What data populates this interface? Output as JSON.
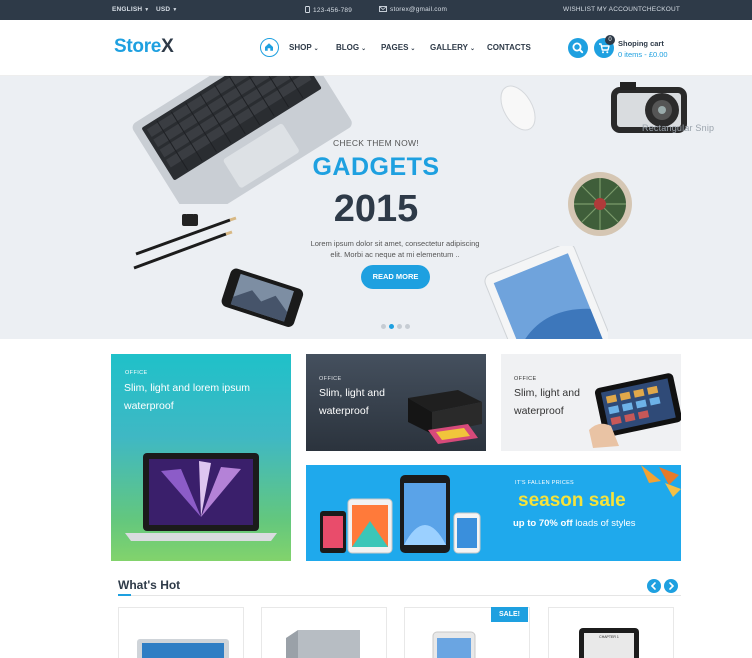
{
  "topbar": {
    "language": "ENGLISH",
    "currency": "USD",
    "phone": "123-456-789",
    "email": "storex@gmail.com",
    "wishlist": "WISHLIST",
    "my_account": "MY ACCOUNT",
    "checkout": "CHECKOUT"
  },
  "header": {
    "logo_main": "Store",
    "logo_accent": "X",
    "nav": [
      "SHOP",
      "BLOG",
      "PAGES",
      "GALLERY",
      "CONTACTS"
    ],
    "cart_title": "Shoping cart",
    "cart_summary": "0 items - £0.00",
    "cart_count": "0"
  },
  "hero": {
    "kicker": "CHECK THEM NOW!",
    "title": "GADGETS",
    "year": "2015",
    "text_line1": "Lorem ipsum dolor sit amet, consectetur adipiscing",
    "text_line2": "elit. Morbi ac neque at mi elementum ..",
    "button": "READ MORE",
    "slides": 4,
    "active_slide": 2,
    "overlay_label": "Rectangular Snip"
  },
  "banners": [
    {
      "tag": "OFFICE",
      "line1": "Slim, light and lorem ipsum",
      "line2": "waterproof"
    },
    {
      "tag": "OFFICE",
      "line1": "Slim, light and",
      "line2": "waterproof"
    },
    {
      "tag": "OFFICE",
      "line1": "Slim, light and",
      "line2": "waterproof"
    }
  ],
  "sale": {
    "kicker": "IT'S FALLEN PRICES",
    "title": "season sale",
    "sub_prefix": "up to 70% off",
    "sub_suffix": "loads of styles"
  },
  "hot": {
    "title": "What's Hot",
    "sale_badge": "SALE!",
    "chapter_label": "CHAPTER 1"
  },
  "colors": {
    "accent": "#1ea0e0",
    "dark": "#2e3a48",
    "sale_yellow": "#f5e33b"
  }
}
